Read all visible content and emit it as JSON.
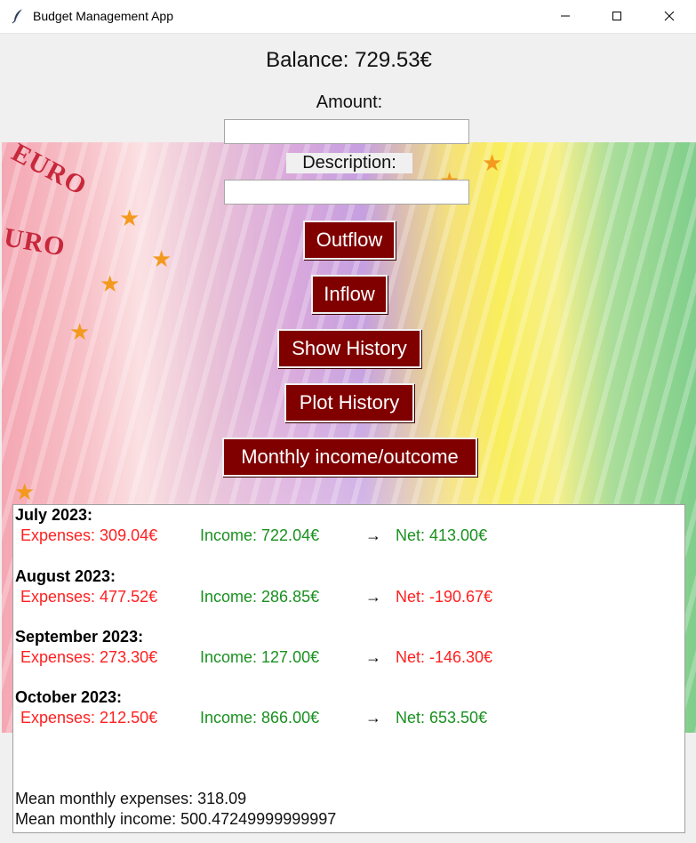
{
  "window": {
    "title": "Budget Management App",
    "app_icon": "feather-icon",
    "controls": [
      "minimize-icon",
      "maximize-icon",
      "close-icon"
    ]
  },
  "balance": {
    "text": "Balance: 729.53€"
  },
  "form": {
    "amount_label": "Amount:",
    "amount_value": "",
    "description_label": "Description:",
    "description_value": ""
  },
  "buttons": {
    "outflow": "Outflow",
    "inflow": "Inflow",
    "show_history": "Show History",
    "plot_history": "Plot History",
    "monthly": "Monthly income/outcome"
  },
  "colors": {
    "button_bg": "#800000",
    "expense": "#ff2020",
    "income": "#1a9020"
  },
  "history": {
    "months": [
      {
        "title": "July 2023:",
        "expenses": "Expenses: 309.04€",
        "income": "Income: 722.04€",
        "arrow": "→",
        "net": "Net: 413.00€",
        "net_sign": "positive"
      },
      {
        "title": "August 2023:",
        "expenses": "Expenses: 477.52€",
        "income": "Income: 286.85€",
        "arrow": "→",
        "net": "Net: -190.67€",
        "net_sign": "negative"
      },
      {
        "title": "September 2023:",
        "expenses": "Expenses: 273.30€",
        "income": "Income: 127.00€",
        "arrow": "→",
        "net": "Net: -146.30€",
        "net_sign": "negative"
      },
      {
        "title": "October 2023:",
        "expenses": "Expenses: 212.50€",
        "income": "Income: 866.00€",
        "arrow": "→",
        "net": "Net: 653.50€",
        "net_sign": "positive"
      }
    ],
    "mean_expenses": "Mean monthly expenses: 318.09",
    "mean_income": "Mean monthly income: 500.47249999999997"
  }
}
